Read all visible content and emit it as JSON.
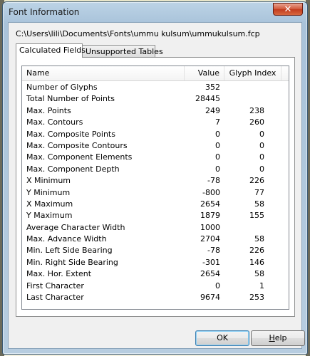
{
  "window": {
    "title": "Font Information",
    "close_label": "✕"
  },
  "path": "C:\\Users\\lili\\Documents\\Fonts\\ummu kulsum\\ummukulsum.fcp",
  "tabs": [
    {
      "label": "Calculated Fields",
      "active": true
    },
    {
      "label": "Unsupported Tables",
      "active": false
    }
  ],
  "table": {
    "columns": [
      "Name",
      "Value",
      "Glyph Index"
    ],
    "rows": [
      {
        "name": "Number of Glyphs",
        "value": "352",
        "glyph": ""
      },
      {
        "name": "Total Number of Points",
        "value": "28445",
        "glyph": ""
      },
      {
        "name": "Max. Points",
        "value": "249",
        "glyph": "238"
      },
      {
        "name": "Max. Contours",
        "value": "7",
        "glyph": "260"
      },
      {
        "name": "Max. Composite Points",
        "value": "0",
        "glyph": "0"
      },
      {
        "name": "Max. Composite Contours",
        "value": "0",
        "glyph": "0"
      },
      {
        "name": "Max. Component Elements",
        "value": "0",
        "glyph": "0"
      },
      {
        "name": "Max. Component Depth",
        "value": "0",
        "glyph": "0"
      },
      {
        "name": "X Minimum",
        "value": "-78",
        "glyph": "226"
      },
      {
        "name": "Y Minimum",
        "value": "-800",
        "glyph": "77"
      },
      {
        "name": "X Maximum",
        "value": "2654",
        "glyph": "58"
      },
      {
        "name": "Y Maximum",
        "value": "1879",
        "glyph": "155"
      },
      {
        "name": "Average Character Width",
        "value": "1000",
        "glyph": ""
      },
      {
        "name": "Max. Advance Width",
        "value": "2704",
        "glyph": "58"
      },
      {
        "name": "Min. Left Side Bearing",
        "value": "-78",
        "glyph": "226"
      },
      {
        "name": "Min. Right Side Bearing",
        "value": "-301",
        "glyph": "146"
      },
      {
        "name": "Max. Hor. Extent",
        "value": "2654",
        "glyph": "58"
      },
      {
        "name": "First Character",
        "value": "0",
        "glyph": "1"
      },
      {
        "name": "Last Character",
        "value": "9674",
        "glyph": "253"
      }
    ]
  },
  "buttons": {
    "ok": "OK",
    "help_first": "H",
    "help_rest": "elp"
  }
}
